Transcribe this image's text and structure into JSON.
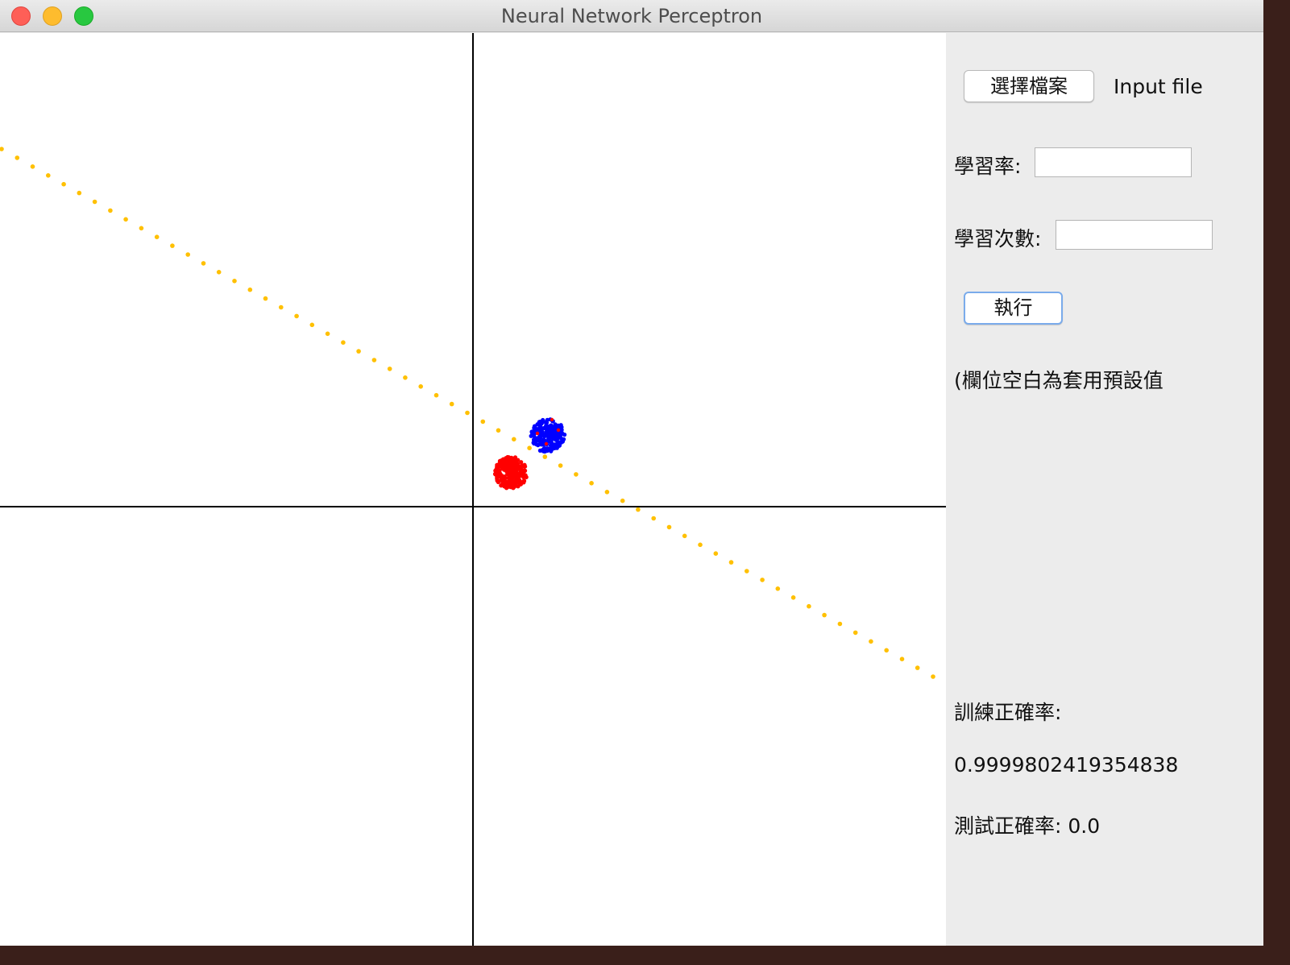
{
  "window": {
    "title": "Neural Network Perceptron"
  },
  "controls": {
    "choose_file_label": "選擇檔案",
    "input_file_label": "Input file",
    "learning_rate_label": "學習率:",
    "learning_rate_value": "",
    "iterations_label": "學習次數:",
    "iterations_value": "",
    "run_label": "執行",
    "default_hint": "(欄位空白為套用預設值"
  },
  "results": {
    "train_accuracy_label": "訓練正確率:",
    "train_accuracy_value": "0.9999802419354838",
    "test_accuracy_label": "測試正確率:",
    "test_accuracy_value": "0.0"
  },
  "colors": {
    "class_a": "#ff0000",
    "class_b": "#0000ff",
    "decision_line": "#ffc000",
    "axes": "#000000"
  }
}
